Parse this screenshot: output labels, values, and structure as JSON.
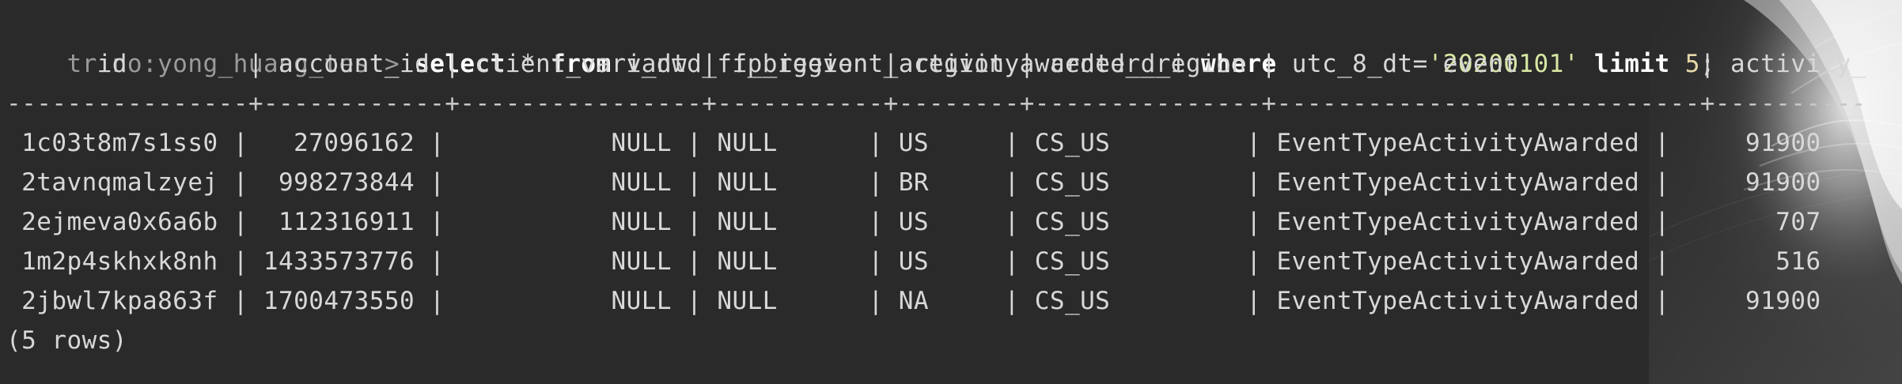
{
  "prompt": "trino:yong_huang_test>",
  "query": {
    "select_kw": "select",
    "star": " * ",
    "from_kw": "from",
    "table": " v_dwd_ff_bigevent_activityawarded_d_i ",
    "where_kw": "where",
    "condition_left": " utc_8_dt=",
    "condition_value": "'20200101'",
    "space": " ",
    "limit_kw": "limit",
    "limit_value": " 5",
    "semicolon": ";"
  },
  "table": {
    "header": "      id        | account_id | client_variant | ip_region | region | center_region |           event            | activity_",
    "separator": "----------------+------------+----------------+-----------+--------+---------------+----------------------------+----------",
    "rows": [
      " 1c03t8m7s1ss0 |   27096162 |           NULL | NULL      | US     | CS_US         | EventTypeActivityAwarded |     91900",
      " 2tavnqmalzyej |  998273844 |           NULL | NULL      | BR     | CS_US         | EventTypeActivityAwarded |     91900",
      " 2ejmeva0x6a6b |  112316911 |           NULL | NULL      | US     | CS_US         | EventTypeActivityAwarded |       707",
      " 1m2p4skhxk8nh | 1433573776 |           NULL | NULL      | US     | CS_US         | EventTypeActivityAwarded |       516",
      " 2jbwl7kpa863f | 1700473550 |           NULL | NULL      | NA     | CS_US         | EventTypeActivityAwarded |     91900"
    ]
  },
  "footer": "(5 rows)"
}
